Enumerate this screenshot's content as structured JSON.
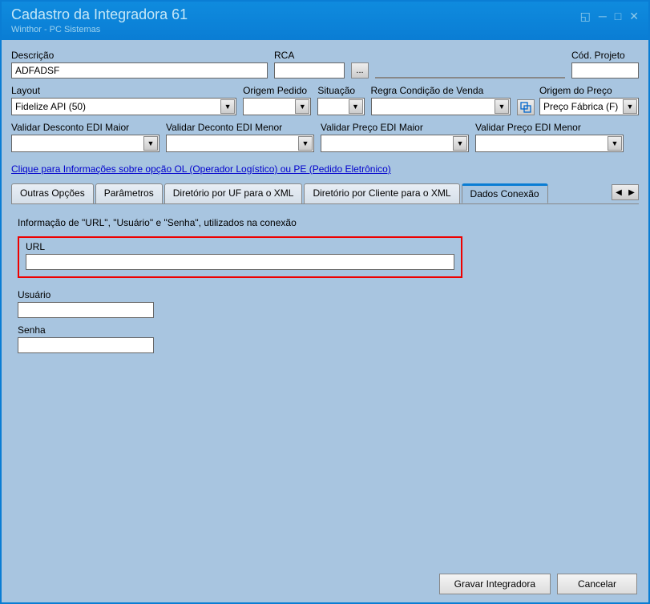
{
  "window": {
    "title": "Cadastro da Integradora 61",
    "subtitle": "Winthor - PC Sistemas"
  },
  "fields": {
    "descricao": {
      "label": "Descrição",
      "value": "ADFADSF"
    },
    "rca": {
      "label": "RCA",
      "value": ""
    },
    "cod_projeto": {
      "label": "Cód. Projeto",
      "value": ""
    },
    "layout": {
      "label": "Layout",
      "value": "Fidelize API (50)"
    },
    "origem_pedido": {
      "label": "Origem Pedido",
      "value": ""
    },
    "situacao": {
      "label": "Situação",
      "value": ""
    },
    "regra_cond_venda": {
      "label": "Regra Condição de Venda",
      "value": ""
    },
    "origem_preco": {
      "label": "Origem do Preço",
      "value": "Preço Fábrica (F)"
    },
    "validar_desc_maior": {
      "label": "Validar Desconto EDI Maior",
      "value": ""
    },
    "validar_desc_menor": {
      "label": "Validar Deconto EDI Menor",
      "value": ""
    },
    "validar_preco_maior": {
      "label": "Validar Preço EDI Maior",
      "value": ""
    },
    "validar_preco_menor": {
      "label": "Validar Preço EDI Menor",
      "value": ""
    }
  },
  "info_link": "Clique para Informações sobre opção OL (Operador Logístico) ou PE (Pedido Eletrônico)",
  "tabs": {
    "t1": "Outras Opções",
    "t2": "Parâmetros",
    "t3": "Diretório por UF para o XML",
    "t4": "Diretório por Cliente para o XML",
    "t5": "Dados Conexão"
  },
  "connection": {
    "section": "Informação de \"URL\", \"Usuário\" e \"Senha\", utilizados na conexão",
    "url_label": "URL",
    "url_value": "",
    "usuario_label": "Usuário",
    "usuario_value": "",
    "senha_label": "Senha",
    "senha_value": ""
  },
  "buttons": {
    "gravar": "Gravar Integradora",
    "cancelar": "Cancelar",
    "browse": "..."
  }
}
